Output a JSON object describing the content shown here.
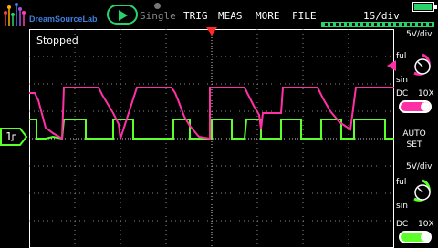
{
  "header": {
    "brand": "DreamSourceLab",
    "run_state_label": "Single",
    "menu": [
      "TRIG",
      "MEAS",
      "MORE",
      "FILE"
    ],
    "time_div": "1S/div"
  },
  "status": {
    "text": "Stopped"
  },
  "channel_marker": {
    "label": "1"
  },
  "channels": [
    {
      "name": "ch1",
      "volts_div": "5V/div",
      "coupling_label": "DC",
      "probe_label": "10X",
      "knob_top": "ful",
      "knob_bottom": "sin",
      "color": "#ff2fa6",
      "enabled": true
    },
    {
      "name": "ch2",
      "volts_div": "5V/div",
      "coupling_label": "DC",
      "probe_label": "10X",
      "knob_top": "ful",
      "knob_bottom": "sin",
      "color": "#5cff2a",
      "enabled": true
    }
  ],
  "autoset": {
    "line1": "AUTO",
    "line2": "SET"
  },
  "colors": {
    "accent_green": "#27d36a",
    "trace_pink": "#ff2fa6",
    "trace_green": "#5cff2a",
    "grid": "#ffffff"
  }
}
